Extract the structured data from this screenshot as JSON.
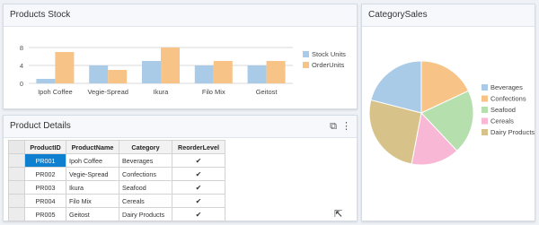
{
  "stock_panel": {
    "title": "Products Stock"
  },
  "sales_panel": {
    "title": "CategorySales"
  },
  "details_panel": {
    "title": "Product Details",
    "icons": [
      "export-icon",
      "more-options-icon"
    ]
  },
  "colors": {
    "stock": "#a9cbe8",
    "order": "#f7c386",
    "selected": "#0f7fcf"
  },
  "chart_data": [
    {
      "type": "bar",
      "categories": [
        "Ipoh Coffee",
        "Vegie-Spread",
        "Ikura",
        "Filo Mix",
        "Geitost"
      ],
      "series": [
        {
          "name": "Stock Units",
          "values": [
            1,
            4,
            5,
            4,
            4
          ],
          "color": "#a9cbe8"
        },
        {
          "name": "OrderUnits",
          "values": [
            7,
            3,
            8,
            5,
            5
          ],
          "color": "#f7c386"
        }
      ],
      "yticks": [
        "8",
        "4",
        "0"
      ],
      "ylim": [
        0,
        10
      ],
      "grid": true,
      "legend": "right"
    },
    {
      "type": "pie",
      "labels": [
        "Beverages",
        "Confections",
        "Seafood",
        "Cereals",
        "Dairy Products"
      ],
      "values": [
        21,
        18,
        20,
        15,
        26
      ],
      "colors": [
        "#a9cbe8",
        "#f7c386",
        "#b5dfad",
        "#f7b7d5",
        "#d7c38a"
      ],
      "legend": "right"
    }
  ],
  "grid": {
    "columns": [
      "ProductID",
      "ProductName",
      "Category",
      "ReorderLevel"
    ],
    "rows": [
      {
        "id": "PR001",
        "name": "Ipoh Coffee",
        "category": "Beverages",
        "reorder": "✔"
      },
      {
        "id": "PR002",
        "name": "Vegie-Spread",
        "category": "Confections",
        "reorder": "✔"
      },
      {
        "id": "PR003",
        "name": "Ikura",
        "category": "Seafood",
        "reorder": "✔"
      },
      {
        "id": "PR004",
        "name": "Filo Mix",
        "category": "Cereals",
        "reorder": "✔"
      },
      {
        "id": "PR005",
        "name": "Geitost",
        "category": "Dairy Products",
        "reorder": "✔"
      }
    ]
  }
}
